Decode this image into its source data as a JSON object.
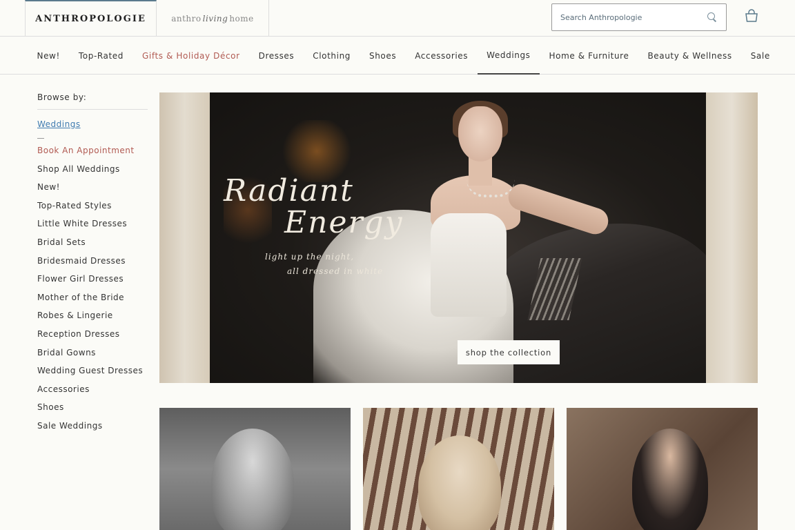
{
  "header": {
    "brand": "ANTHROPOLOGIE",
    "living_home": {
      "prefix": "anthro",
      "script": "living",
      "suffix": "home"
    },
    "search_placeholder": "Search Anthropologie",
    "icons": {
      "search": "search-icon",
      "bag": "shopping-bag-icon"
    }
  },
  "nav": {
    "items": [
      {
        "label": "New!"
      },
      {
        "label": "Top-Rated"
      },
      {
        "label": "Gifts & Holiday Décor",
        "color": "#b15a52"
      },
      {
        "label": "Dresses"
      },
      {
        "label": "Clothing"
      },
      {
        "label": "Shoes"
      },
      {
        "label": "Accessories"
      },
      {
        "label": "Weddings",
        "active": true
      },
      {
        "label": "Home & Furniture"
      },
      {
        "label": "Beauty & Wellness"
      },
      {
        "label": "Sale"
      }
    ]
  },
  "sidebar": {
    "heading": "Browse by:",
    "current": "Weddings",
    "items": [
      {
        "label": "Book An Appointment",
        "color": "#b15a52"
      },
      {
        "label": "Shop All Weddings"
      },
      {
        "label": "New!"
      },
      {
        "label": "Top-Rated Styles"
      },
      {
        "label": "Little White Dresses"
      },
      {
        "label": "Bridal Sets"
      },
      {
        "label": "Bridesmaid Dresses"
      },
      {
        "label": "Flower Girl Dresses"
      },
      {
        "label": "Mother of the Bride"
      },
      {
        "label": "Robes & Lingerie"
      },
      {
        "label": "Reception Dresses"
      },
      {
        "label": "Bridal Gowns"
      },
      {
        "label": "Wedding Guest Dresses"
      },
      {
        "label": "Accessories"
      },
      {
        "label": "Shoes"
      },
      {
        "label": "Sale Weddings"
      }
    ]
  },
  "hero": {
    "title_line1": "Radiant",
    "title_line2": "Energy",
    "tagline_line1": "light up the night,",
    "tagline_line2": "all dressed in white",
    "cta": "shop the collection"
  },
  "colors": {
    "accent": "#b15a52",
    "link": "#3f7bb0",
    "background": "#fbfbf7"
  }
}
